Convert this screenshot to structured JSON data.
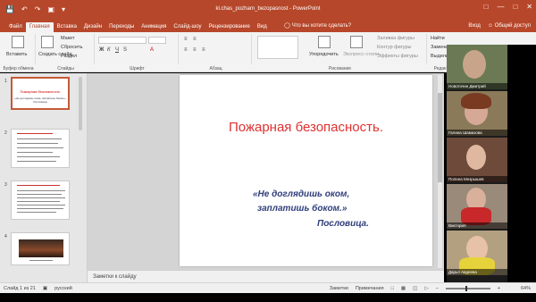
{
  "app": {
    "title": "kl.chas_pozharn_bezopasnost - PowerPoint",
    "accent": "#b7472a",
    "qat": [
      "save-icon",
      "undo-icon",
      "redo-icon",
      "present-icon"
    ],
    "window_controls": [
      "minimize-icon",
      "maximize-icon",
      "close-icon"
    ]
  },
  "ribbon_tabs": [
    "Файл",
    "Главная",
    "Вставка",
    "Дизайн",
    "Переходы",
    "Анимация",
    "Слайд-шоу",
    "Рецензирование",
    "Вид"
  ],
  "active_tab": "Главная",
  "tell_me": "Что вы хотите сделать?",
  "right_tabs": {
    "signin": "Вход",
    "share": "Общий доступ"
  },
  "ribbon": {
    "clipboard": {
      "paste": "Вставить",
      "cut": "Макет",
      "copy": "Сбросить",
      "format": "Раздел",
      "label": "Буфер обмена"
    },
    "slides": {
      "new_slide": "Создать слайд",
      "label": "Слайды"
    },
    "font": {
      "label": "Шрифт"
    },
    "paragraph": {
      "label": "Абзац"
    },
    "drawing": {
      "arrange": "Упорядочить",
      "quick_styles": "Экспресс-стили",
      "fill": "Заливка фигуры",
      "outline": "Контур фигуры",
      "effects": "Эффекты фигуры",
      "label": "Рисование"
    },
    "editing": {
      "find": "Найти",
      "replace": "Заменить",
      "select": "Выделить",
      "label": "Редакти"
    }
  },
  "thumbnails": [
    {
      "num": "1",
      "title": "Пожарная безопасность",
      "sub": "«Не доглядишь оком, заплатишь боком.» Пословица",
      "selected": true
    },
    {
      "num": "2",
      "title": "Так себе…",
      "sub": "",
      "selected": false
    },
    {
      "num": "3",
      "title": "",
      "sub": "",
      "selected": false
    },
    {
      "num": "4",
      "title": "",
      "sub": "",
      "selected": false
    }
  ],
  "slide": {
    "title": "Пожарная безопасность.",
    "line1": "«Не доглядишь оком,",
    "line2": "заплатишь боком.»",
    "line3": "Пословица.",
    "title_color": "#e03131",
    "quote_color": "#2f3e7a"
  },
  "notes_placeholder": "Заметки к слайду",
  "status": {
    "slide_info": "Слайд 1 из 21",
    "language": "русский",
    "notes": "Заметки",
    "comments": "Примечания",
    "zoom": "64%",
    "zoom_level": 0.64
  },
  "participants": [
    {
      "name": "Новоточин Дмитрий",
      "bg": "#6b7a55"
    },
    {
      "name": "Галина Шамазова",
      "bg": "#8b7a5a"
    },
    {
      "name": "Полина Мезрышев",
      "bg": "#6d4a3a"
    },
    {
      "name": "Виктория",
      "bg": "#9a8a7a"
    },
    {
      "name": "Дарья Авдеева",
      "bg": "#b2a080"
    }
  ]
}
